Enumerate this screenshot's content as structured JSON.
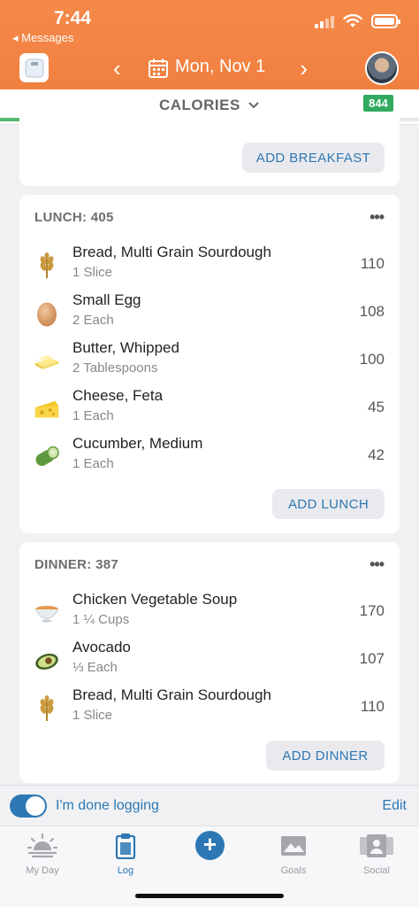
{
  "status": {
    "time": "7:44",
    "back_label": "◂ Messages"
  },
  "header": {
    "date": "Mon, Nov 1",
    "prev_glyph": "‹",
    "next_glyph": "›"
  },
  "calories": {
    "label": "CALORIES",
    "remaining": "844",
    "progress_fraction": 0.33
  },
  "breakfast": {
    "add_label": "ADD BREAKFAST"
  },
  "lunch": {
    "title": "LUNCH: 405",
    "more": "•••",
    "items": [
      {
        "name": "Bread, Multi Grain Sourdough",
        "qty": "1 Slice",
        "cal": "110",
        "icon": "wheat-icon"
      },
      {
        "name": "Small Egg",
        "qty": "2 Each",
        "cal": "108",
        "icon": "egg-icon"
      },
      {
        "name": "Butter, Whipped",
        "qty": "2 Tablespoons",
        "cal": "100",
        "icon": "butter-icon"
      },
      {
        "name": "Cheese, Feta",
        "qty": "1 Each",
        "cal": "45",
        "icon": "cheese-icon"
      },
      {
        "name": "Cucumber, Medium",
        "qty": "1 Each",
        "cal": "42",
        "icon": "cucumber-icon"
      }
    ],
    "add_label": "ADD LUNCH"
  },
  "dinner": {
    "title": "DINNER: 387",
    "more": "•••",
    "items": [
      {
        "name": "Chicken Vegetable Soup",
        "qty": "1 ¼ Cups",
        "cal": "170",
        "icon": "soup-bowl-icon"
      },
      {
        "name": "Avocado",
        "qty": "⅓ Each",
        "cal": "107",
        "icon": "avocado-icon"
      },
      {
        "name": "Bread, Multi Grain Sourdough",
        "qty": "1 Slice",
        "cal": "110",
        "icon": "wheat-icon"
      }
    ],
    "add_label": "ADD DINNER"
  },
  "done": {
    "label": "I'm done logging",
    "edit": "Edit"
  },
  "tabs": [
    {
      "label": "My Day",
      "icon": "sunrise-icon"
    },
    {
      "label": "Log",
      "icon": "clipboard-icon"
    },
    {
      "label": "",
      "icon": "plus-icon"
    },
    {
      "label": "Goals",
      "icon": "goals-icon"
    },
    {
      "label": "Social",
      "icon": "social-icon"
    }
  ],
  "colors": {
    "header": "#f08040",
    "accent": "#2d78b4",
    "badge": "#2faa5e"
  }
}
